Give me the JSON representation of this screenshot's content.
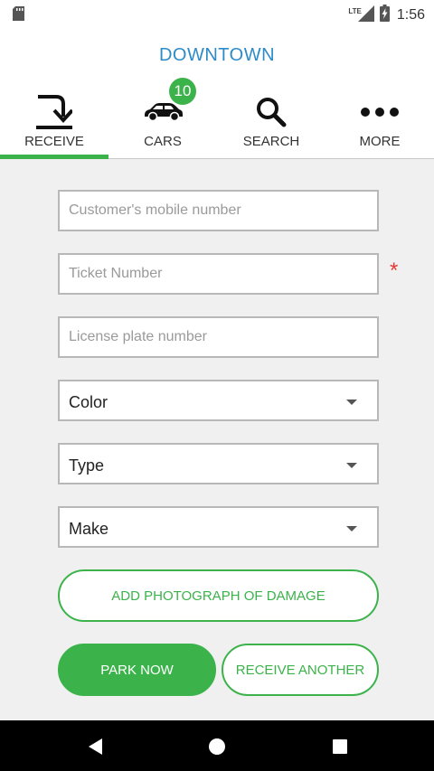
{
  "status_bar": {
    "network": "LTE",
    "time": "1:56",
    "icons": [
      "sd-card-icon",
      "signal-icon",
      "battery-charging-icon"
    ]
  },
  "header": {
    "title": "DOWNTOWN",
    "title_color": "#2e8bc8"
  },
  "tabs": [
    {
      "label": "RECEIVE",
      "icon": "receive-icon",
      "active": true
    },
    {
      "label": "CARS",
      "icon": "car-icon",
      "badge": "10"
    },
    {
      "label": "SEARCH",
      "icon": "search-icon"
    },
    {
      "label": "MORE",
      "icon": "more-dots-icon"
    }
  ],
  "form": {
    "mobile_placeholder": "Customer's mobile number",
    "ticket_placeholder": "Ticket Number",
    "ticket_required_mark": "*",
    "plate_placeholder": "License plate number",
    "color_select": "Color",
    "type_select": "Type",
    "make_select": "Make"
  },
  "buttons": {
    "add_photo": "ADD PHOTOGRAPH OF DAMAGE",
    "park_now": "PARK NOW",
    "receive_another": "RECEIVE ANOTHER"
  },
  "nav_bar": {
    "icons": [
      "back-icon",
      "home-icon",
      "recents-icon"
    ]
  },
  "colors": {
    "accent_green": "#3bb34a",
    "title_blue": "#2e8bc8",
    "required_red": "#e53935"
  }
}
